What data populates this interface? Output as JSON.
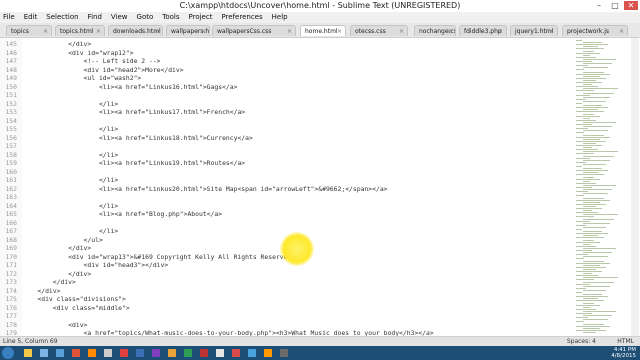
{
  "window": {
    "title": "C:\\xampp\\htdocs\\Uncover\\home.html - Sublime Text (UNREGISTERED)"
  },
  "menu": [
    "File",
    "Edit",
    "Selection",
    "Find",
    "View",
    "Goto",
    "Tools",
    "Project",
    "Preferences",
    "Help"
  ],
  "tabs": [
    {
      "label": "topics",
      "active": false
    },
    {
      "label": "topics.html",
      "active": false
    },
    {
      "label": "downloads.html",
      "active": false
    },
    {
      "label": "wallpapers.html",
      "active": false
    },
    {
      "label": "wallpapersCss.css",
      "active": false
    },
    {
      "label": "home.html",
      "active": true
    },
    {
      "label": "otecss.css",
      "active": false
    },
    {
      "label": "nochange.css",
      "active": false
    },
    {
      "label": "fdiddle3.php",
      "active": false
    },
    {
      "label": "jquery1.html",
      "active": false
    },
    {
      "label": "projectwork.js",
      "active": false
    }
  ],
  "code": [
    {
      "n": "145",
      "t": "            </div>"
    },
    {
      "n": "146",
      "t": "            <div id=\"wrap12\">"
    },
    {
      "n": "147",
      "t": "                <!-- Left side 2 -->"
    },
    {
      "n": "148",
      "t": "                <div id=\"head2\">More</div>"
    },
    {
      "n": "149",
      "t": "                <ul id=\"wash2\">"
    },
    {
      "n": "150",
      "t": "                    <li><a href=\"Linkus16.html\">Gags</a>"
    },
    {
      "n": "151",
      "t": ""
    },
    {
      "n": "152",
      "t": "                    </li>"
    },
    {
      "n": "153",
      "t": "                    <li><a href=\"Linkus17.html\">French</a>"
    },
    {
      "n": "154",
      "t": ""
    },
    {
      "n": "155",
      "t": "                    </li>"
    },
    {
      "n": "156",
      "t": "                    <li><a href=\"Linkus18.html\">Currency</a>"
    },
    {
      "n": "157",
      "t": ""
    },
    {
      "n": "158",
      "t": "                    </li>"
    },
    {
      "n": "159",
      "t": "                    <li><a href=\"Linkus19.html\">Routes</a>"
    },
    {
      "n": "160",
      "t": ""
    },
    {
      "n": "161",
      "t": "                    </li>"
    },
    {
      "n": "162",
      "t": "                    <li><a href=\"Linkus20.html\">Site Map<span id=\"arrowLeft\">&#9662;</span></a>"
    },
    {
      "n": "163",
      "t": ""
    },
    {
      "n": "164",
      "t": "                    </li>"
    },
    {
      "n": "165",
      "t": "                    <li><a href=\"Blog.php\">About</a>"
    },
    {
      "n": "166",
      "t": ""
    },
    {
      "n": "167",
      "t": "                    </li>"
    },
    {
      "n": "168",
      "t": "                </ul>"
    },
    {
      "n": "169",
      "t": "            </div>"
    },
    {
      "n": "170",
      "t": "            <div id=\"wrap13\">&#169 Copyright Kelly All Rights Reserved"
    },
    {
      "n": "171",
      "t": "                <div id=\"head3\"></div>"
    },
    {
      "n": "172",
      "t": "            </div>"
    },
    {
      "n": "173",
      "t": "        </div>"
    },
    {
      "n": "174",
      "t": "    </div>"
    },
    {
      "n": "175",
      "t": "    <div class=\"divisions\">"
    },
    {
      "n": "176",
      "t": "        <div class=\"middle\">"
    },
    {
      "n": "177",
      "t": ""
    },
    {
      "n": "178",
      "t": "            <div>"
    },
    {
      "n": "179",
      "t": "                <a href=\"topics/What-music-does-to-your-body.php\"><h3>What Music does to your body</h3></a>"
    }
  ],
  "status": {
    "position": "Line 5, Column 69",
    "spaces": "Spaces: 4",
    "syntax": "HTML"
  },
  "tray": {
    "time": "4:41 PM",
    "date": "4/8/2015"
  }
}
